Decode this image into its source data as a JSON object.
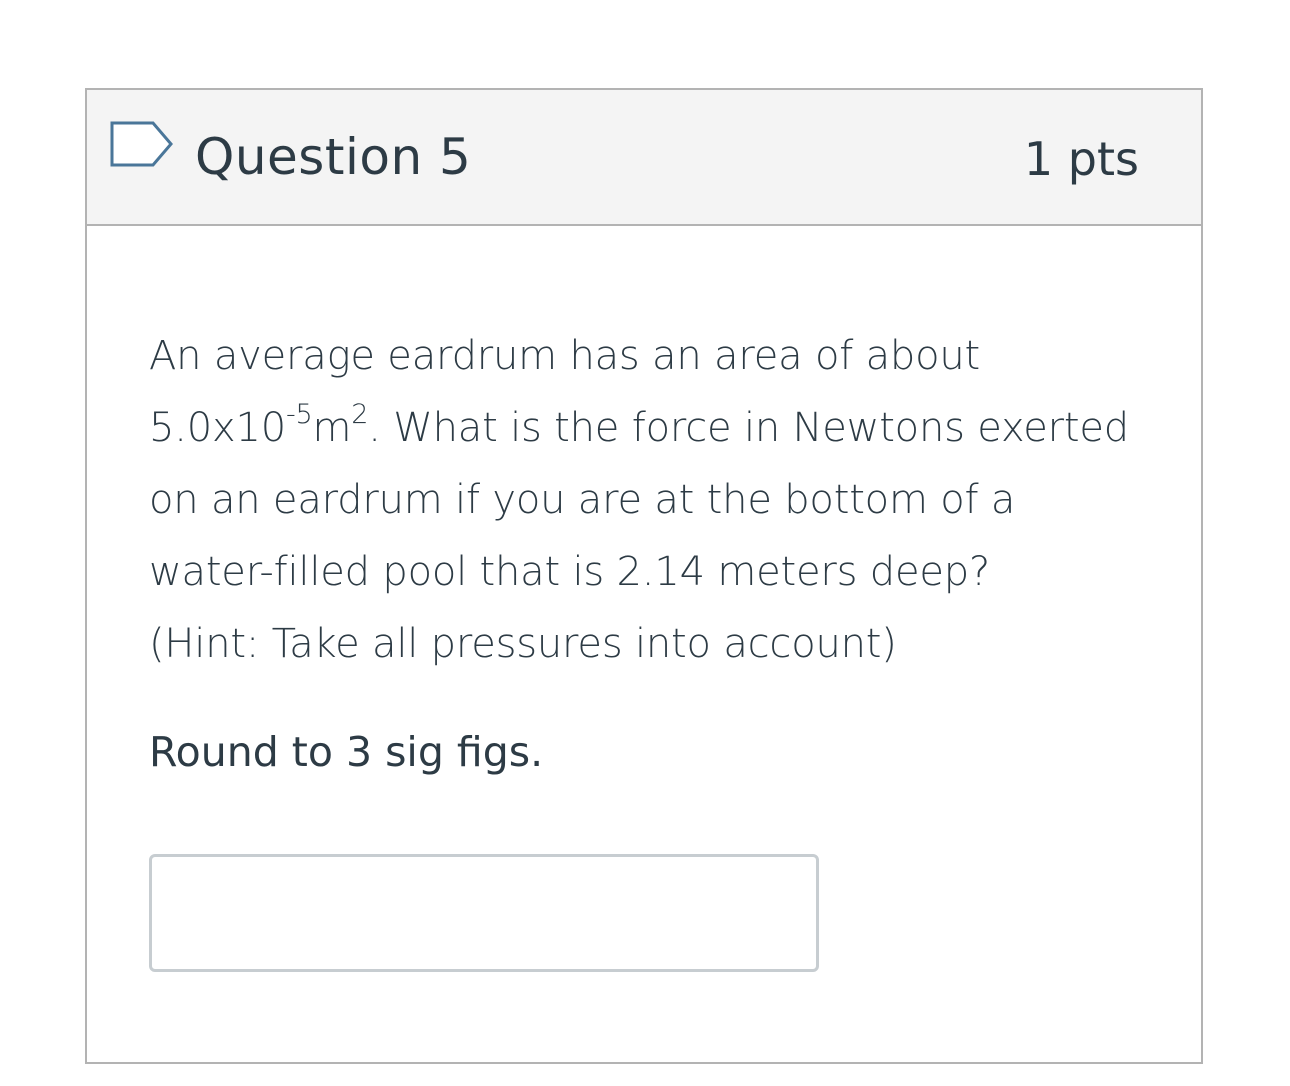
{
  "question": {
    "title": "Question 5",
    "points": "1 pts",
    "flag_icon": "bookmark-flag-icon",
    "flag_color": "#4a7699",
    "text_parts": {
      "line1": "An average eardrum has an area of about",
      "value_prefix": "5.0x10",
      "exponent1": "-5",
      "unit_m": "m",
      "exponent2": "2",
      "rest": ".  What is the force in Newtons exerted on an eardrum if you are at the bottom of a water-filled pool that is 2.14 meters deep?",
      "hint": "(Hint: Take all pressures into account)"
    },
    "instruction": "Round to 3 sig figs.",
    "answer_value": "",
    "answer_placeholder": ""
  }
}
